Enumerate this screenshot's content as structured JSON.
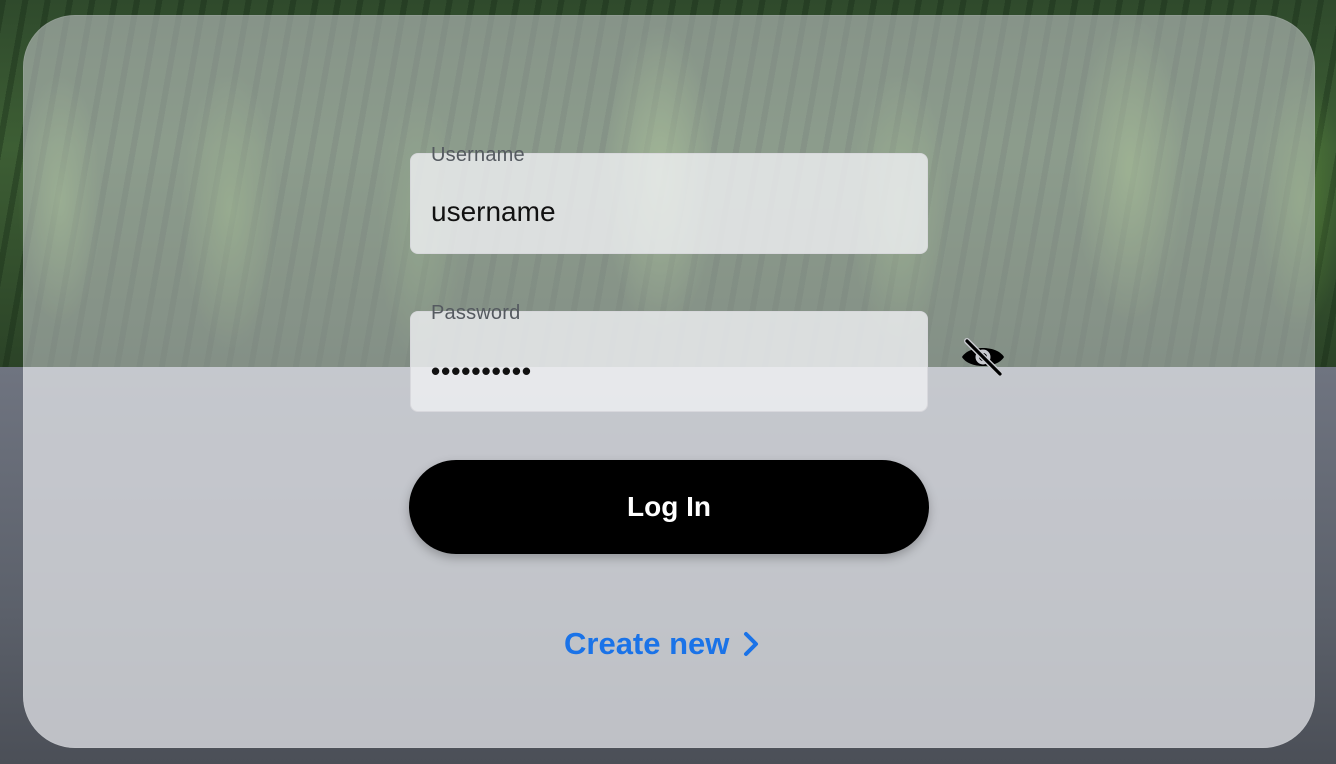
{
  "login_form": {
    "username": {
      "label": "Username",
      "value": "username"
    },
    "password": {
      "label": "Password",
      "value": "••••••••••",
      "visibility_icon": "eye-off-icon"
    },
    "login_button_label": "Log In",
    "create_link": {
      "label": "Create new",
      "icon": "chevron-right-icon"
    }
  },
  "colors": {
    "button_background": "#000000",
    "button_text": "#ffffff",
    "link": "#1a73e8",
    "label": "#555a60"
  }
}
